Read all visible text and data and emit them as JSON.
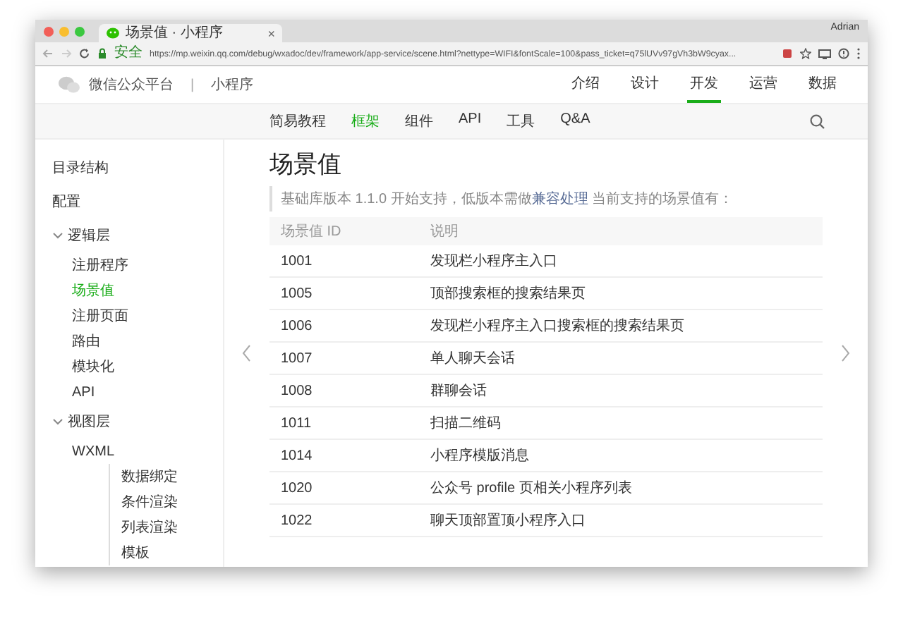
{
  "browser": {
    "tab": {
      "title": "场景值 · 小程序",
      "close": "×"
    },
    "user": "Adrian",
    "security": "安全",
    "url": "https://mp.weixin.qq.com/debug/wxadoc/dev/framework/app-service/scene.html?nettype=WIFI&fontScale=100&pass_ticket=q75lUVv97gVh3bW9cyax..."
  },
  "site": {
    "brand": "微信公众平台",
    "separator": "|",
    "product": "小程序",
    "nav": [
      {
        "label": "介绍",
        "selected": false
      },
      {
        "label": "设计",
        "selected": false
      },
      {
        "label": "开发",
        "selected": true
      },
      {
        "label": "运营",
        "selected": false
      },
      {
        "label": "数据",
        "selected": false
      }
    ]
  },
  "subnav": [
    {
      "label": "简易教程",
      "selected": false
    },
    {
      "label": "框架",
      "selected": true
    },
    {
      "label": "组件",
      "selected": false
    },
    {
      "label": "API",
      "selected": false
    },
    {
      "label": "工具",
      "selected": false
    },
    {
      "label": "Q&A",
      "selected": false
    }
  ],
  "sidebar": {
    "items": [
      {
        "label": "目录结构",
        "selected": false
      },
      {
        "label": "配置",
        "selected": false
      },
      {
        "label": "逻辑层",
        "selected": false,
        "expanded": true,
        "children": [
          {
            "label": "注册程序",
            "selected": false
          },
          {
            "label": "场景值",
            "selected": true
          },
          {
            "label": "注册页面",
            "selected": false
          },
          {
            "label": "路由",
            "selected": false
          },
          {
            "label": "模块化",
            "selected": false
          },
          {
            "label": "API",
            "selected": false
          }
        ]
      },
      {
        "label": "视图层",
        "selected": false,
        "expanded": true,
        "children": [
          {
            "label": "WXML",
            "selected": false,
            "children": [
              {
                "label": "数据绑定",
                "selected": false
              },
              {
                "label": "条件渲染",
                "selected": false
              },
              {
                "label": "列表渲染",
                "selected": false
              },
              {
                "label": "模板",
                "selected": false
              }
            ]
          }
        ]
      }
    ]
  },
  "doc": {
    "title": "场景值",
    "note": {
      "before": "基础库版本 1.1.0 开始支持，低版本需做",
      "link": "兼容处理",
      "after": "当前支持的场景值有："
    },
    "table": {
      "columns": [
        "场景值 ID",
        "说明"
      ],
      "rows": [
        [
          "1001",
          "发现栏小程序主入口"
        ],
        [
          "1005",
          "顶部搜索框的搜索结果页"
        ],
        [
          "1006",
          "发现栏小程序主入口搜索框的搜索结果页"
        ],
        [
          "1007",
          "单人聊天会话"
        ],
        [
          "1008",
          "群聊会话"
        ],
        [
          "1011",
          "扫描二维码"
        ],
        [
          "1014",
          "小程序模版消息"
        ],
        [
          "1020",
          "公众号 profile 页相关小程序列表"
        ],
        [
          "1022",
          "聊天顶部置顶小程序入口"
        ]
      ]
    }
  }
}
